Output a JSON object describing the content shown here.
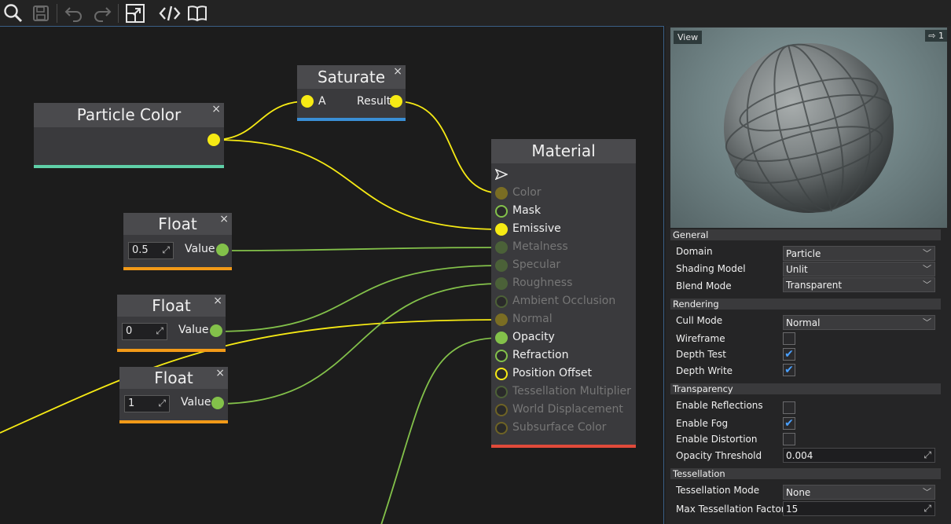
{
  "toolbar": {
    "buttons": [
      "search-icon",
      "save-icon",
      "undo-icon",
      "redo-icon",
      "resize-icon",
      "code-icon",
      "book-icon"
    ]
  },
  "nodes": {
    "particle_color": {
      "title": "Particle Color",
      "close": "×"
    },
    "saturate": {
      "title": "Saturate",
      "close": "×",
      "input": "A",
      "output": "Result"
    },
    "float1": {
      "title": "Float",
      "close": "×",
      "value": "0.5",
      "output": "Value"
    },
    "float2": {
      "title": "Float",
      "close": "×",
      "value": "0",
      "output": "Value"
    },
    "float3": {
      "title": "Float",
      "close": "×",
      "value": "1",
      "output": "Value"
    },
    "material": {
      "title": "Material",
      "pins": [
        "Color",
        "Mask",
        "Emissive",
        "Metalness",
        "Specular",
        "Roughness",
        "Ambient Occlusion",
        "Normal",
        "Opacity",
        "Refraction",
        "Position Offset",
        "Tessellation Multiplier",
        "World Displacement",
        "Subsurface Color"
      ]
    }
  },
  "preview": {
    "label": "View",
    "control": "1"
  },
  "properties": {
    "general": {
      "header": "General",
      "domain_label": "Domain",
      "domain_value": "Particle",
      "shading_label": "Shading Model",
      "shading_value": "Unlit",
      "blend_label": "Blend Mode",
      "blend_value": "Transparent"
    },
    "rendering": {
      "header": "Rendering",
      "cull_label": "Cull Mode",
      "cull_value": "Normal",
      "wireframe_label": "Wireframe",
      "wireframe": false,
      "depth_test_label": "Depth Test",
      "depth_test": true,
      "depth_write_label": "Depth Write",
      "depth_write": true
    },
    "transparency": {
      "header": "Transparency",
      "reflections_label": "Enable Reflections",
      "reflections": false,
      "fog_label": "Enable Fog",
      "fog": true,
      "distortion_label": "Enable Distortion",
      "distortion": false,
      "opacity_threshold_label": "Opacity Threshold",
      "opacity_threshold": "0.004"
    },
    "tessellation": {
      "header": "Tessellation",
      "mode_label": "Tessellation Mode",
      "mode_value": "None",
      "max_factor_label": "Max Tessellation Factor",
      "max_factor": "15"
    }
  },
  "colors": {
    "yellow_wire": "#f6ea14",
    "green_wire": "#83c14a",
    "particle_color_accent": "#5fd0a8",
    "saturate_accent": "#3a8fd6",
    "float_accent": "#f29a18",
    "material_accent": "#e04a3a"
  }
}
